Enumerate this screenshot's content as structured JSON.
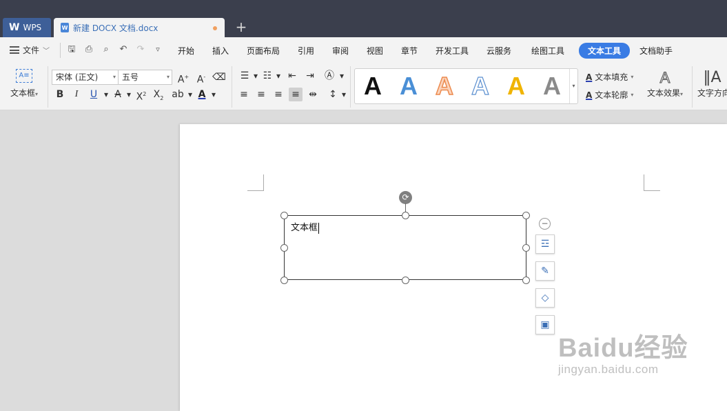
{
  "tabs": {
    "app_tab": "WPS",
    "document_tab": "新建 DOCX 文档.docx",
    "document_icon_letter": "W",
    "new_tab": "+"
  },
  "menu": {
    "file": "文件",
    "items": [
      "开始",
      "插入",
      "页面布局",
      "引用",
      "审阅",
      "视图",
      "章节",
      "开发工具",
      "云服务",
      "绘图工具",
      "文本工具",
      "文档助手"
    ],
    "active": "文本工具"
  },
  "ribbon": {
    "textbox_label": "文本框",
    "textbox_icon_text": "A≡",
    "font_name": "宋体 (正文)",
    "font_size": "五号",
    "style_gallery": [
      "A",
      "A",
      "A",
      "A",
      "A",
      "A"
    ],
    "text_fill": "文本填充",
    "text_outline": "文本轮廓",
    "text_effect": "文本效果",
    "text_direction": "文字方向"
  },
  "document": {
    "textbox_content": "文本框"
  },
  "watermark": {
    "main": "Baidu经验",
    "sub": "jingyan.baidu.com"
  },
  "colors": {
    "titlebar": "#3b3f4d",
    "accent": "#3a7ce4",
    "gallery_black": "#111111",
    "gallery_blue": "#4a8fd6",
    "gallery_orange": "#f0a070",
    "gallery_outline_blue": "#5b8fd0",
    "gallery_yellow": "#f0b400",
    "gallery_gray": "#8a8a8a"
  }
}
